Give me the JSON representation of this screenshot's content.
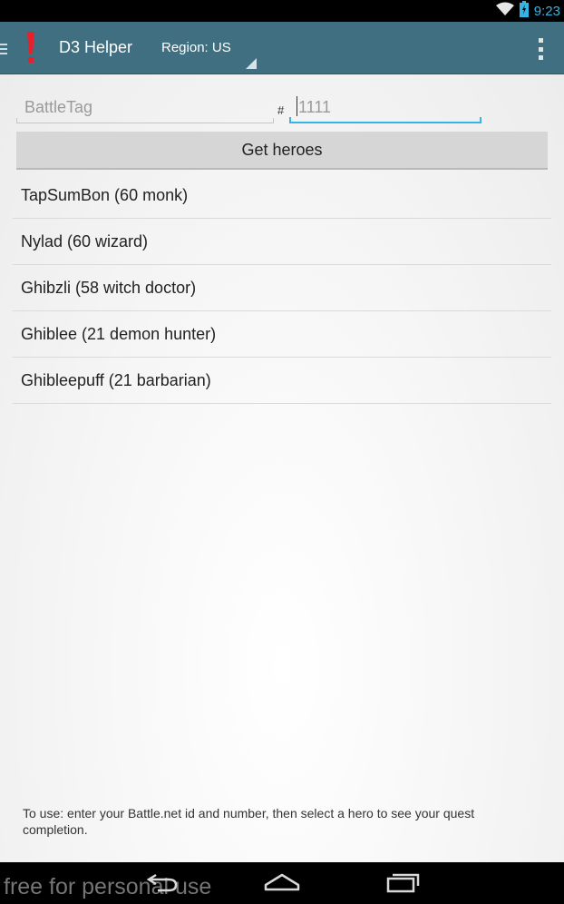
{
  "status_bar": {
    "time": "9:23"
  },
  "action_bar": {
    "title": "D3 Helper",
    "region_label": "Region: US"
  },
  "form": {
    "battletag_placeholder": "BattleTag",
    "hash": "#",
    "number_placeholder": "1111",
    "get_heroes_label": "Get heroes"
  },
  "heroes": [
    {
      "label": "TapSumBon (60 monk)"
    },
    {
      "label": "Nylad (60 wizard)"
    },
    {
      "label": "Ghibzli (58 witch doctor)"
    },
    {
      "label": "Ghiblee (21 demon hunter)"
    },
    {
      "label": "Ghibleepuff (21 barbarian)"
    }
  ],
  "instructions": "To use: enter your Battle.net id and number, then select a hero to see your quest completion.",
  "nav_bar": {
    "watermark": "free for personal use"
  },
  "colors": {
    "action_bar": "#3f6f80",
    "accent": "#33b5e5",
    "logo": "#e8202a"
  },
  "icons": [
    "wifi-icon",
    "battery-icon",
    "drawer-icon",
    "exclamation-logo-icon",
    "overflow-menu-icon",
    "back-icon",
    "home-icon",
    "recent-apps-icon"
  ]
}
